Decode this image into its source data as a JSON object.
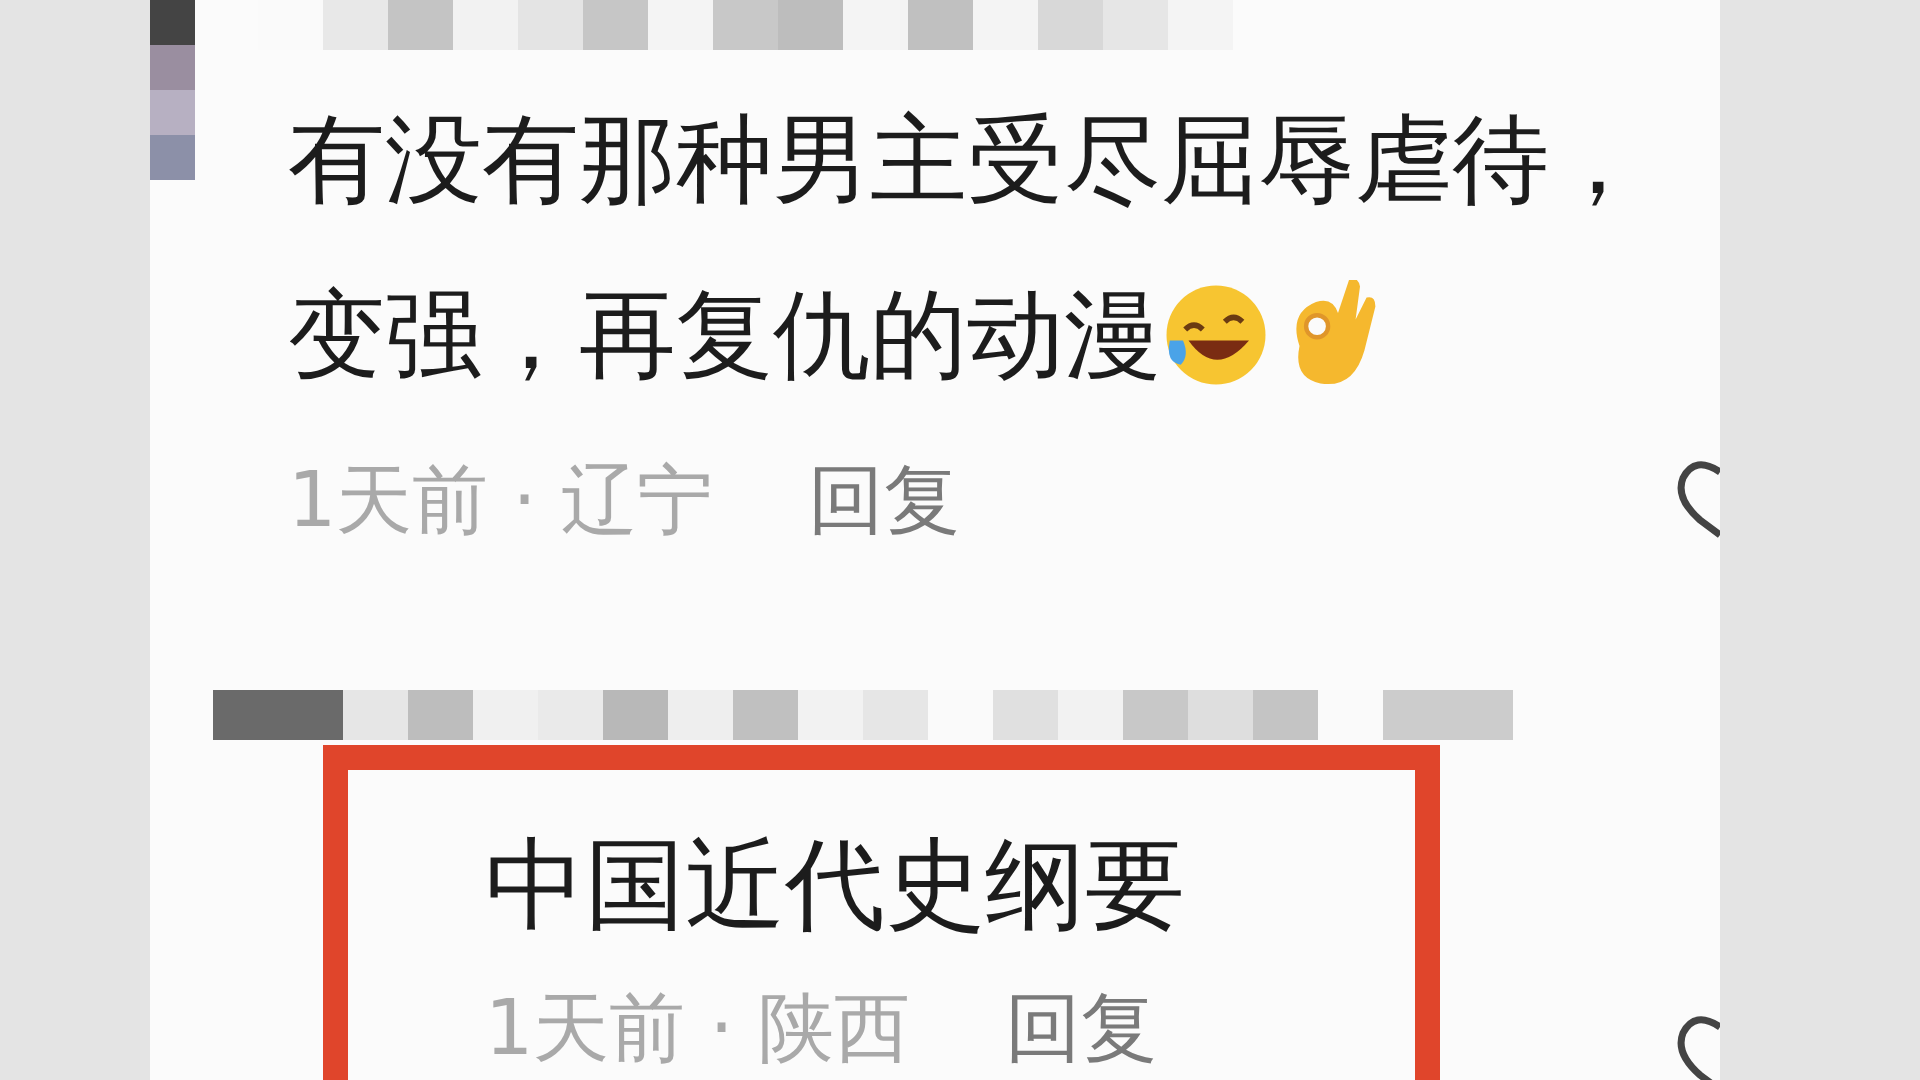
{
  "comments": [
    {
      "text_lines": [
        "有没有那种男主受尽屈辱虐待，",
        "变强，再复仇的动漫"
      ],
      "emoji": true,
      "meta": "1天前 · 辽宁",
      "reply": "回复"
    },
    {
      "text_lines": [
        "中国近代史纲要"
      ],
      "emoji": false,
      "meta": "1天前 · 陕西",
      "reply": "回复",
      "highlighted": true
    }
  ]
}
